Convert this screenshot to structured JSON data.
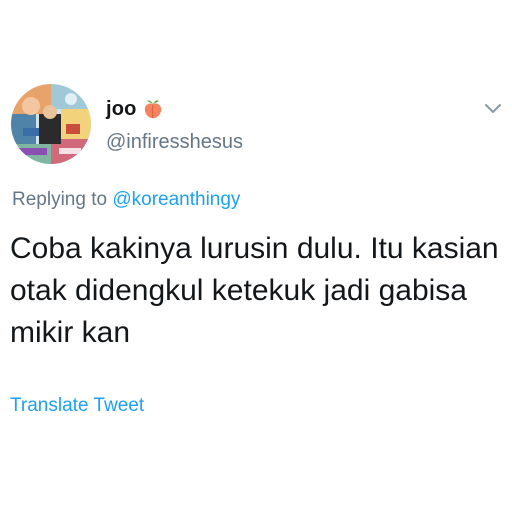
{
  "user": {
    "display_name": "joo",
    "handle": "@infiresshesus",
    "avatar_icon": "avatar-collage-image",
    "name_emoji": "peach-icon"
  },
  "reply": {
    "prefix": "Replying to ",
    "mention": "@koreanthingy"
  },
  "tweet": {
    "text": "Coba kakinya lurusin dulu. Itu kasian otak didengkul ketekuk jadi gabisa mikir kan"
  },
  "actions": {
    "translate_label": "Translate Tweet",
    "more_icon": "chevron-down-icon"
  },
  "colors": {
    "text_primary": "#14171a",
    "text_secondary": "#657786",
    "link": "#1da1f2",
    "peach": "#f4845f"
  }
}
